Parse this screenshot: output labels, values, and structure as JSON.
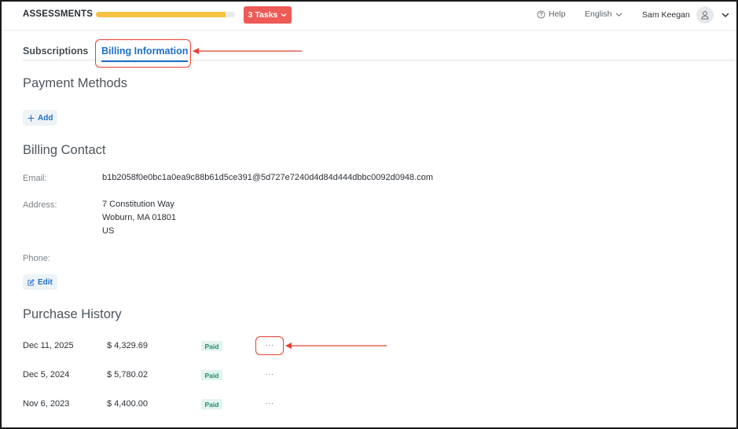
{
  "header": {
    "brand": "ASSESSMENTS",
    "progress_fraction": 0.93,
    "tasks_label": "3 Tasks",
    "help_label": "Help",
    "language_label": "English",
    "user_name": "Sam Keegan"
  },
  "tabs": [
    {
      "label": "Subscriptions",
      "active": false
    },
    {
      "label": "Billing Information",
      "active": true
    }
  ],
  "payment_methods": {
    "title": "Payment Methods",
    "add_label": "Add"
  },
  "billing_contact": {
    "title": "Billing Contact",
    "email_label": "Email:",
    "email_value": "b1b2058f0e0bc1a0ea9c88b61d5ce391@5d727e7240d4d84d444dbbc0092d0948.com",
    "address_label": "Address:",
    "address_lines": [
      "7 Constitution Way",
      "Woburn, MA 01801",
      "US"
    ],
    "phone_label": "Phone:",
    "edit_label": "Edit"
  },
  "purchase_history": {
    "title": "Purchase History",
    "rows": [
      {
        "date": "Dec 11, 2025",
        "amount": "$ 4,329.69",
        "status": "Paid",
        "more": "···"
      },
      {
        "date": "Dec 5, 2024",
        "amount": "$ 5,780.02",
        "status": "Paid",
        "more": "···"
      },
      {
        "date": "Nov 6, 2023",
        "amount": "$ 4,400.00",
        "status": "Paid",
        "more": "···"
      }
    ]
  },
  "colors": {
    "accent_blue": "#1e70c9",
    "tasks_red": "#ee5a55",
    "progress_yellow": "#f6c244",
    "annotation_red": "#e8412f",
    "paid_green": "#2a8a6f"
  },
  "icons": {
    "tasks_chevron": "chevron-down-icon",
    "help": "help-circle-icon",
    "language_chevron": "chevron-down-icon",
    "avatar": "user-icon",
    "user_chevron": "chevron-down-icon",
    "add": "plus-icon",
    "edit": "edit-icon"
  }
}
